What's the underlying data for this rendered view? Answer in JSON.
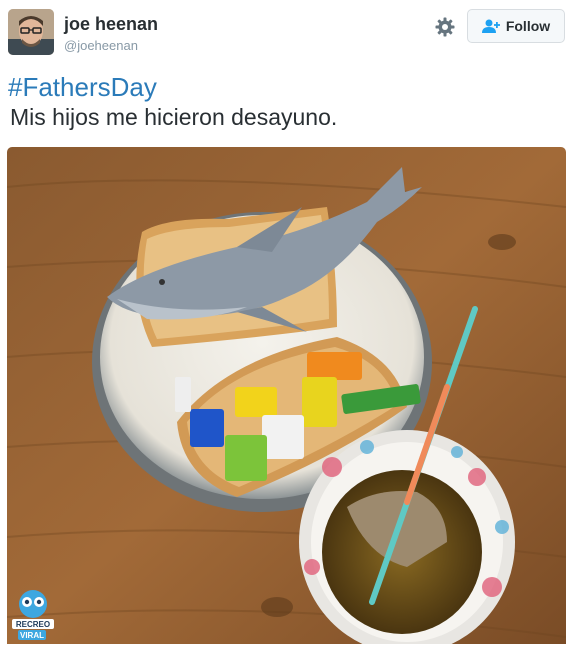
{
  "tweet": {
    "author_name": "joe heenan",
    "author_handle": "@joeheenan",
    "follow_label": "Follow",
    "hashtag": "#FathersDay",
    "text": "Mis hijos me hicieron desayuno.",
    "settings_icon": "gear-icon",
    "follow_icon": "add-user-icon"
  },
  "photo": {
    "description_icon": "photo",
    "watermark_text": "RECREO VIRAL"
  },
  "colors": {
    "hashtag": "#2b7bb9",
    "text": "#292f33",
    "handle": "#8899a6",
    "follow_icon": "#1da1f2"
  }
}
